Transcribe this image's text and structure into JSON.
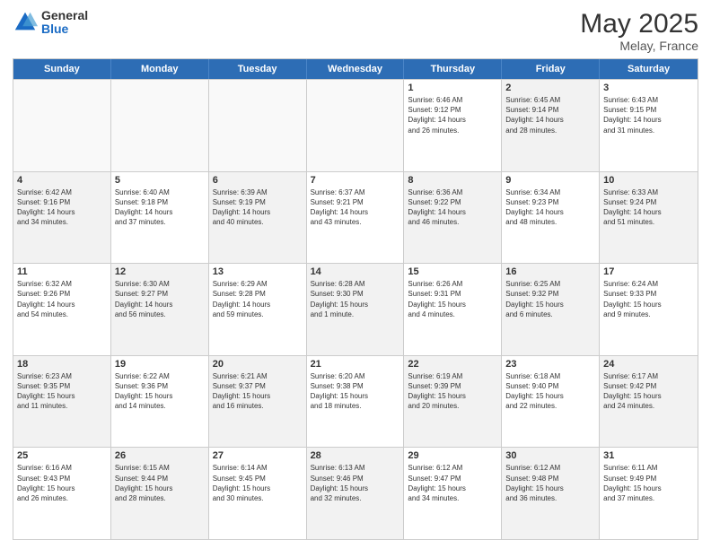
{
  "header": {
    "logo_general": "General",
    "logo_blue": "Blue",
    "title": "May 2025",
    "subtitle": "Melay, France"
  },
  "calendar": {
    "weekdays": [
      "Sunday",
      "Monday",
      "Tuesday",
      "Wednesday",
      "Thursday",
      "Friday",
      "Saturday"
    ],
    "rows": [
      [
        {
          "day": "",
          "info": "",
          "empty": true
        },
        {
          "day": "",
          "info": "",
          "empty": true
        },
        {
          "day": "",
          "info": "",
          "empty": true
        },
        {
          "day": "",
          "info": "",
          "empty": true
        },
        {
          "day": "1",
          "info": "Sunrise: 6:46 AM\nSunset: 9:12 PM\nDaylight: 14 hours\nand 26 minutes."
        },
        {
          "day": "2",
          "info": "Sunrise: 6:45 AM\nSunset: 9:14 PM\nDaylight: 14 hours\nand 28 minutes.",
          "shaded": true
        },
        {
          "day": "3",
          "info": "Sunrise: 6:43 AM\nSunset: 9:15 PM\nDaylight: 14 hours\nand 31 minutes."
        }
      ],
      [
        {
          "day": "4",
          "info": "Sunrise: 6:42 AM\nSunset: 9:16 PM\nDaylight: 14 hours\nand 34 minutes.",
          "shaded": true
        },
        {
          "day": "5",
          "info": "Sunrise: 6:40 AM\nSunset: 9:18 PM\nDaylight: 14 hours\nand 37 minutes."
        },
        {
          "day": "6",
          "info": "Sunrise: 6:39 AM\nSunset: 9:19 PM\nDaylight: 14 hours\nand 40 minutes.",
          "shaded": true
        },
        {
          "day": "7",
          "info": "Sunrise: 6:37 AM\nSunset: 9:21 PM\nDaylight: 14 hours\nand 43 minutes."
        },
        {
          "day": "8",
          "info": "Sunrise: 6:36 AM\nSunset: 9:22 PM\nDaylight: 14 hours\nand 46 minutes.",
          "shaded": true
        },
        {
          "day": "9",
          "info": "Sunrise: 6:34 AM\nSunset: 9:23 PM\nDaylight: 14 hours\nand 48 minutes."
        },
        {
          "day": "10",
          "info": "Sunrise: 6:33 AM\nSunset: 9:24 PM\nDaylight: 14 hours\nand 51 minutes.",
          "shaded": true
        }
      ],
      [
        {
          "day": "11",
          "info": "Sunrise: 6:32 AM\nSunset: 9:26 PM\nDaylight: 14 hours\nand 54 minutes."
        },
        {
          "day": "12",
          "info": "Sunrise: 6:30 AM\nSunset: 9:27 PM\nDaylight: 14 hours\nand 56 minutes.",
          "shaded": true
        },
        {
          "day": "13",
          "info": "Sunrise: 6:29 AM\nSunset: 9:28 PM\nDaylight: 14 hours\nand 59 minutes."
        },
        {
          "day": "14",
          "info": "Sunrise: 6:28 AM\nSunset: 9:30 PM\nDaylight: 15 hours\nand 1 minute.",
          "shaded": true
        },
        {
          "day": "15",
          "info": "Sunrise: 6:26 AM\nSunset: 9:31 PM\nDaylight: 15 hours\nand 4 minutes."
        },
        {
          "day": "16",
          "info": "Sunrise: 6:25 AM\nSunset: 9:32 PM\nDaylight: 15 hours\nand 6 minutes.",
          "shaded": true
        },
        {
          "day": "17",
          "info": "Sunrise: 6:24 AM\nSunset: 9:33 PM\nDaylight: 15 hours\nand 9 minutes."
        }
      ],
      [
        {
          "day": "18",
          "info": "Sunrise: 6:23 AM\nSunset: 9:35 PM\nDaylight: 15 hours\nand 11 minutes.",
          "shaded": true
        },
        {
          "day": "19",
          "info": "Sunrise: 6:22 AM\nSunset: 9:36 PM\nDaylight: 15 hours\nand 14 minutes."
        },
        {
          "day": "20",
          "info": "Sunrise: 6:21 AM\nSunset: 9:37 PM\nDaylight: 15 hours\nand 16 minutes.",
          "shaded": true
        },
        {
          "day": "21",
          "info": "Sunrise: 6:20 AM\nSunset: 9:38 PM\nDaylight: 15 hours\nand 18 minutes."
        },
        {
          "day": "22",
          "info": "Sunrise: 6:19 AM\nSunset: 9:39 PM\nDaylight: 15 hours\nand 20 minutes.",
          "shaded": true
        },
        {
          "day": "23",
          "info": "Sunrise: 6:18 AM\nSunset: 9:40 PM\nDaylight: 15 hours\nand 22 minutes."
        },
        {
          "day": "24",
          "info": "Sunrise: 6:17 AM\nSunset: 9:42 PM\nDaylight: 15 hours\nand 24 minutes.",
          "shaded": true
        }
      ],
      [
        {
          "day": "25",
          "info": "Sunrise: 6:16 AM\nSunset: 9:43 PM\nDaylight: 15 hours\nand 26 minutes."
        },
        {
          "day": "26",
          "info": "Sunrise: 6:15 AM\nSunset: 9:44 PM\nDaylight: 15 hours\nand 28 minutes.",
          "shaded": true
        },
        {
          "day": "27",
          "info": "Sunrise: 6:14 AM\nSunset: 9:45 PM\nDaylight: 15 hours\nand 30 minutes."
        },
        {
          "day": "28",
          "info": "Sunrise: 6:13 AM\nSunset: 9:46 PM\nDaylight: 15 hours\nand 32 minutes.",
          "shaded": true
        },
        {
          "day": "29",
          "info": "Sunrise: 6:12 AM\nSunset: 9:47 PM\nDaylight: 15 hours\nand 34 minutes."
        },
        {
          "day": "30",
          "info": "Sunrise: 6:12 AM\nSunset: 9:48 PM\nDaylight: 15 hours\nand 36 minutes.",
          "shaded": true
        },
        {
          "day": "31",
          "info": "Sunrise: 6:11 AM\nSunset: 9:49 PM\nDaylight: 15 hours\nand 37 minutes."
        }
      ]
    ]
  }
}
